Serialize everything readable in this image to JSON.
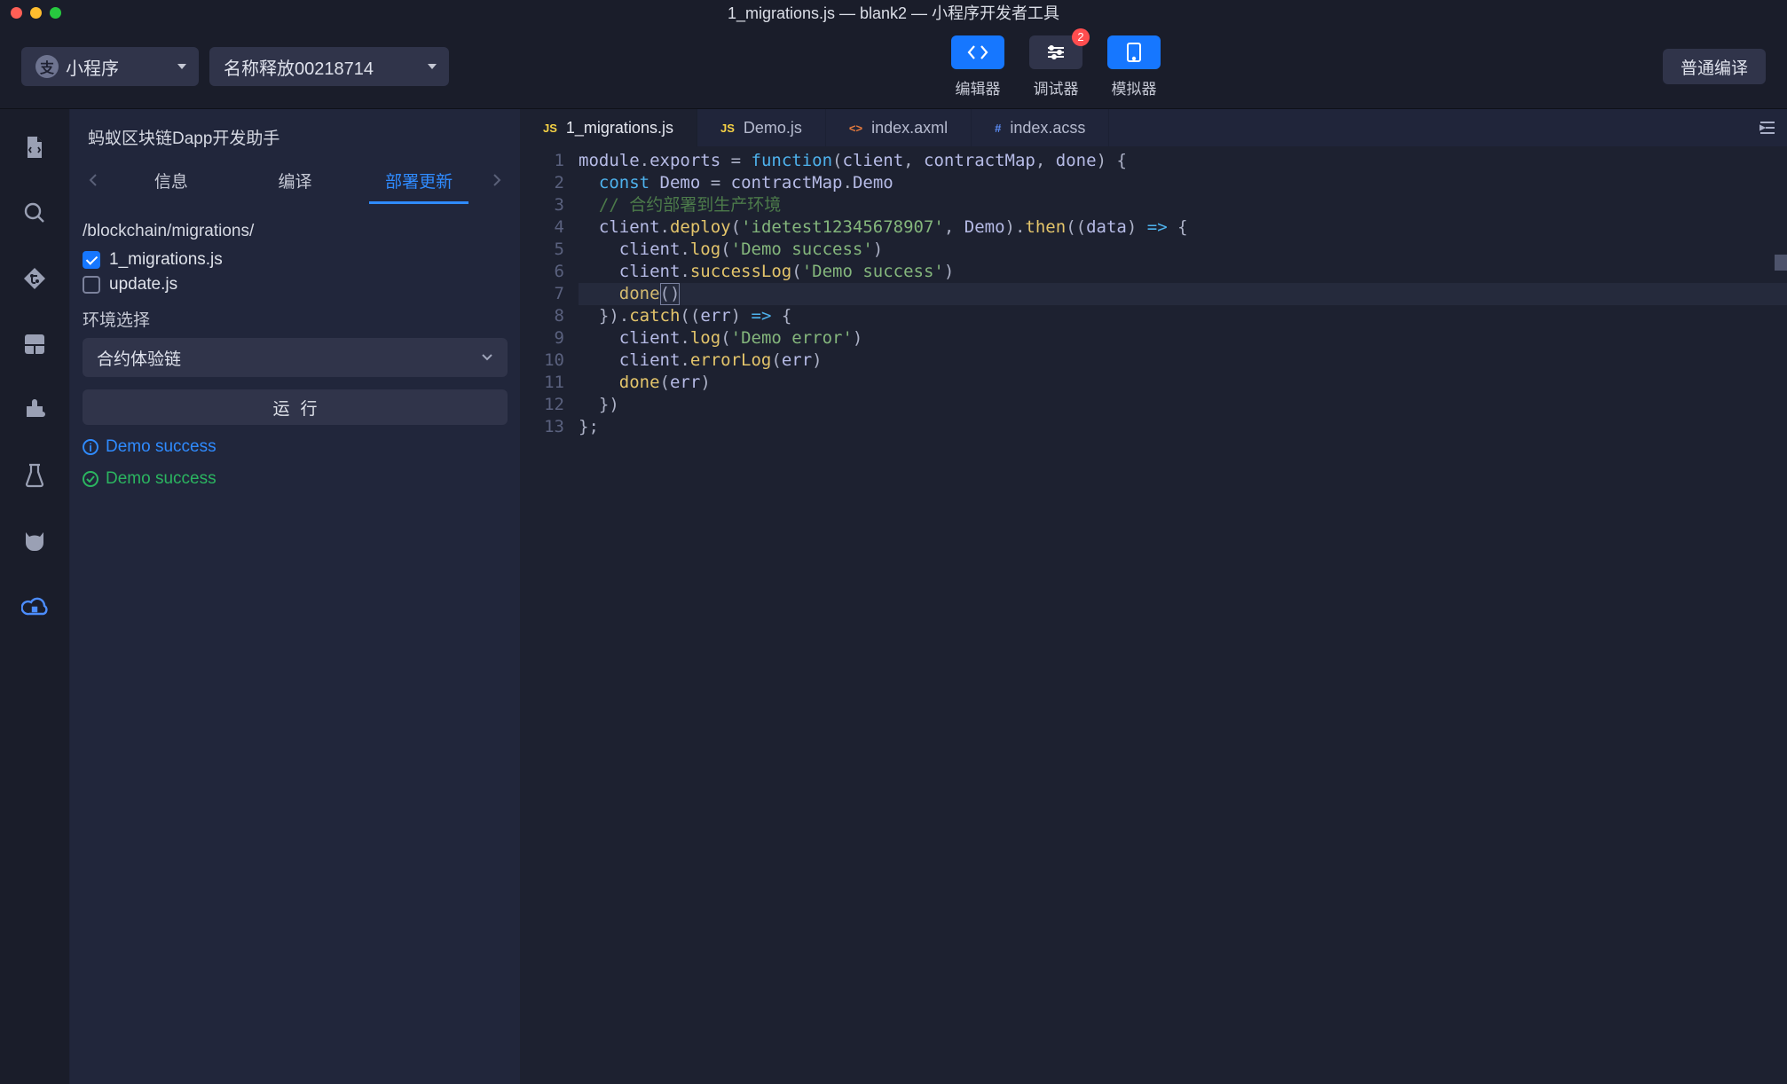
{
  "window": {
    "title": "1_migrations.js — blank2 — 小程序开发者工具"
  },
  "toolbar": {
    "app_type": "小程序",
    "project_name": "名称释放00218714",
    "compile_label": "普通编译",
    "modes": {
      "editor": "编辑器",
      "debugger": "调试器",
      "simulator": "模拟器",
      "badge": "2"
    }
  },
  "activitybar": {
    "items": [
      "file-icon",
      "search-icon",
      "git-icon",
      "blocks-icon",
      "extension-icon",
      "beaker-icon",
      "cat-icon",
      "cloud-icon"
    ]
  },
  "sidepanel": {
    "title": "蚂蚁区块链Dapp开发助手",
    "tabs": {
      "info": "信息",
      "compile": "编译",
      "deploy": "部署更新"
    },
    "path": "/blockchain/migrations/",
    "files": [
      {
        "name": "1_migrations.js",
        "checked": true
      },
      {
        "name": "update.js",
        "checked": false
      }
    ],
    "env_label": "环境选择",
    "env_value": "合约体验链",
    "run_label": "运行",
    "logs": [
      {
        "kind": "info",
        "text": "Demo success"
      },
      {
        "kind": "ok",
        "text": "Demo success"
      }
    ]
  },
  "editor": {
    "tabs": [
      {
        "name": "1_migrations.js",
        "icon": "js",
        "active": true
      },
      {
        "name": "Demo.js",
        "icon": "js",
        "active": false
      },
      {
        "name": "index.axml",
        "icon": "axml",
        "active": false
      },
      {
        "name": "index.acss",
        "icon": "acss",
        "active": false
      }
    ],
    "line_count": 13,
    "code_plain": "module.exports = function(client, contractMap, done) {\n  const Demo = contractMap.Demo\n  // 合约部署到生产环境\n  client.deploy('idetest12345678907', Demo).then((data) => {\n    client.log('Demo success')\n    client.successLog('Demo success')\n    done()\n  }).catch((err) => {\n    client.log('Demo error')\n    client.errorLog(err)\n    done(err)\n  })\n};",
    "code_lines": [
      "<span class='c-id'>module</span><span class='c-pun'>.</span><span class='c-id'>exports</span> <span class='c-pun'>=</span> <span class='c-kw'>function</span><span class='c-pun'>(</span><span class='c-id'>client</span><span class='c-pun'>,</span> <span class='c-id'>contractMap</span><span class='c-pun'>,</span> <span class='c-id'>done</span><span class='c-pun'>) {</span>",
      "  <span class='c-kw'>const</span> <span class='c-id'>Demo</span> <span class='c-pun'>=</span> <span class='c-id'>contractMap</span><span class='c-pun'>.</span><span class='c-id'>Demo</span>",
      "  <span class='c-cmt'>// 合约部署到生产环境</span>",
      "  <span class='c-id'>client</span><span class='c-pun'>.</span><span class='c-fn'>deploy</span><span class='c-pun'>(</span><span class='c-str'>'idetest12345678907'</span><span class='c-pun'>,</span> <span class='c-id'>Demo</span><span class='c-pun'>).</span><span class='c-fn'>then</span><span class='c-pun'>((</span><span class='c-id'>data</span><span class='c-pun'>)</span> <span class='c-op'>=&gt;</span> <span class='c-pun'>{</span>",
      "    <span class='c-id'>client</span><span class='c-pun'>.</span><span class='c-fn'>log</span><span class='c-pun'>(</span><span class='c-str'>'Demo success'</span><span class='c-pun'>)</span>",
      "    <span class='c-id'>client</span><span class='c-pun'>.</span><span class='c-fn'>successLog</span><span class='c-pun'>(</span><span class='c-str'>'Demo success'</span><span class='c-pun'>)</span>",
      "    <span class='c-fn'>done</span><span class='c-pun'>()</span>",
      "  <span class='c-pun'>}).</span><span class='c-fn'>catch</span><span class='c-pun'>((</span><span class='c-id'>err</span><span class='c-pun'>)</span> <span class='c-op'>=&gt;</span> <span class='c-pun'>{</span>",
      "    <span class='c-id'>client</span><span class='c-pun'>.</span><span class='c-fn'>log</span><span class='c-pun'>(</span><span class='c-str'>'Demo error'</span><span class='c-pun'>)</span>",
      "    <span class='c-id'>client</span><span class='c-pun'>.</span><span class='c-fn'>errorLog</span><span class='c-pun'>(</span><span class='c-id'>err</span><span class='c-pun'>)</span>",
      "    <span class='c-fn'>done</span><span class='c-pun'>(</span><span class='c-id'>err</span><span class='c-pun'>)</span>",
      "  <span class='c-pun'>})</span>",
      "<span class='c-pun'>};</span>"
    ]
  }
}
